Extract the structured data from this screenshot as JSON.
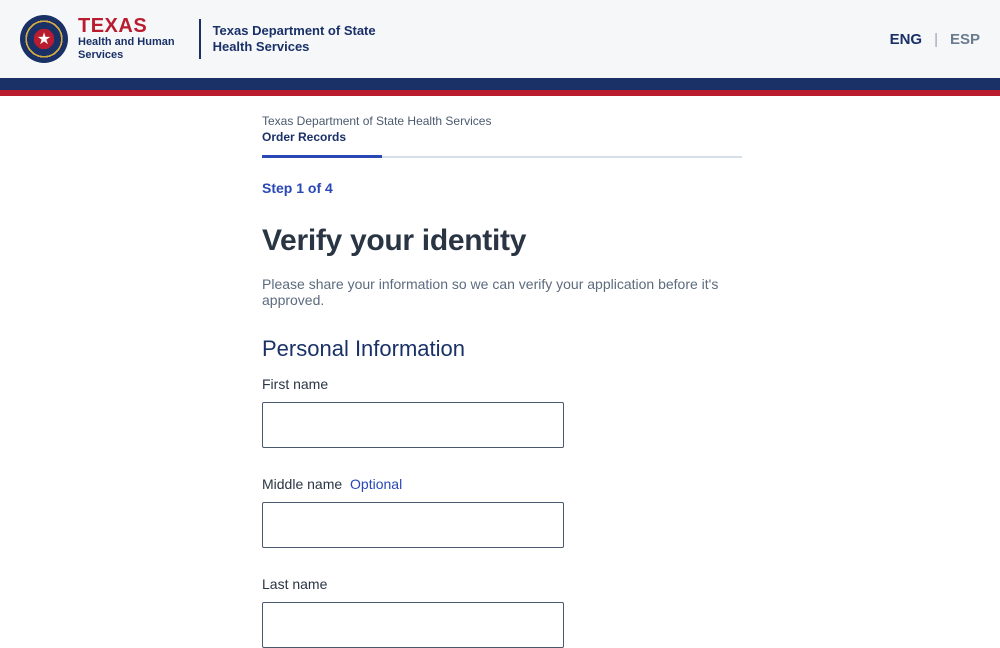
{
  "header": {
    "texas_title": "TEXAS",
    "texas_sub1": "Health and Human",
    "texas_sub2": "Services",
    "dept_line1": "Texas Department of State",
    "dept_line2": "Health Services",
    "lang_eng": "ENG",
    "lang_esp": "ESP"
  },
  "breadcrumb": {
    "dept": "Texas Department of State Health Services",
    "page": "Order Records"
  },
  "progress": {
    "step_label": "Step 1 of 4",
    "current": 1,
    "total": 4
  },
  "page": {
    "heading": "Verify your identity",
    "subtext": "Please share your information so we can verify your application before it's approved."
  },
  "section": {
    "personal_info": "Personal Information"
  },
  "fields": {
    "first_name": {
      "label": "First name",
      "value": ""
    },
    "middle_name": {
      "label": "Middle name",
      "optional": "Optional",
      "value": ""
    },
    "last_name": {
      "label": "Last name",
      "value": ""
    }
  }
}
